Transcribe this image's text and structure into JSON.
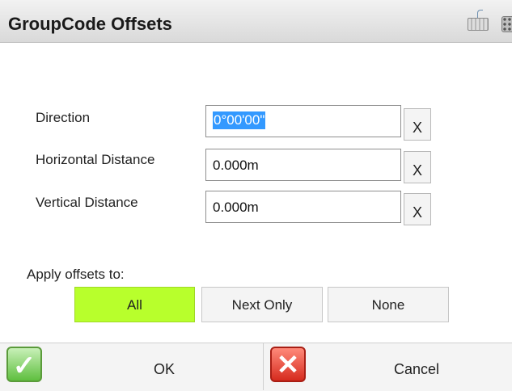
{
  "window": {
    "title": "GroupCode Offsets",
    "icons": [
      "keyboard-icon",
      "grid-icon"
    ]
  },
  "fields": [
    {
      "label": "Direction",
      "value": "0°00'00\"",
      "clear": "X",
      "selected": true
    },
    {
      "label": "Horizontal Distance",
      "value": "0.000m",
      "clear": "X",
      "selected": false
    },
    {
      "label": "Vertical Distance",
      "value": "0.000m",
      "clear": "X",
      "selected": false
    }
  ],
  "apply": {
    "label": "Apply offsets to:",
    "options": [
      "All",
      "Next Only",
      "None"
    ],
    "active": "All",
    "active_color": "#b8ff2c"
  },
  "footer": {
    "ok": "OK",
    "cancel": "Cancel"
  }
}
